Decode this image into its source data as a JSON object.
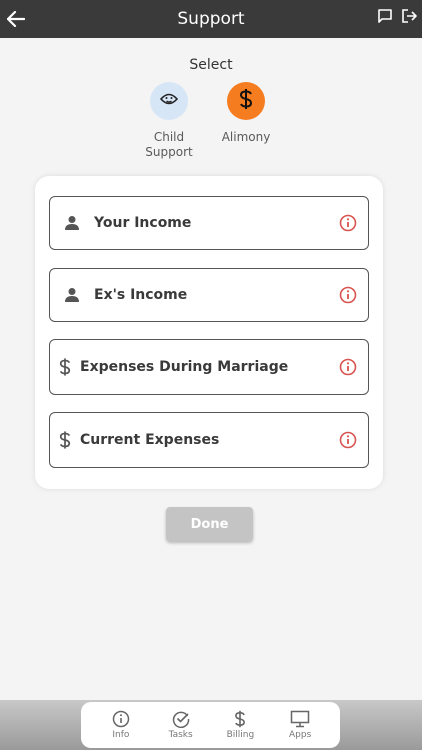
{
  "header": {
    "title": "Support",
    "back_icon": "arrow-left-icon",
    "chat_icon": "comment-icon",
    "logout_icon": "logout-icon"
  },
  "select": {
    "label": "Select",
    "options": [
      {
        "label": "Child Support",
        "icon": "baby-face-icon",
        "selected": false,
        "color": "#d6e6f7"
      },
      {
        "label": "Alimony",
        "icon": "dollar-icon",
        "selected": true,
        "color": "#f57c1f"
      }
    ]
  },
  "fields": [
    {
      "label": "Your Income",
      "icon": "person-icon"
    },
    {
      "label": "Ex's Income",
      "icon": "person-icon"
    },
    {
      "label": "Expenses During Marriage",
      "icon": "dollar-icon"
    },
    {
      "label": "Current Expenses",
      "icon": "dollar-icon"
    }
  ],
  "info_icon_color": "#d9534f",
  "done_button": {
    "label": "Done"
  },
  "tabs": [
    {
      "label": "Info",
      "icon": "info-icon"
    },
    {
      "label": "Tasks",
      "icon": "check-circle-icon"
    },
    {
      "label": "Billing",
      "icon": "dollar-icon"
    },
    {
      "label": "Apps",
      "icon": "monitor-icon"
    }
  ]
}
